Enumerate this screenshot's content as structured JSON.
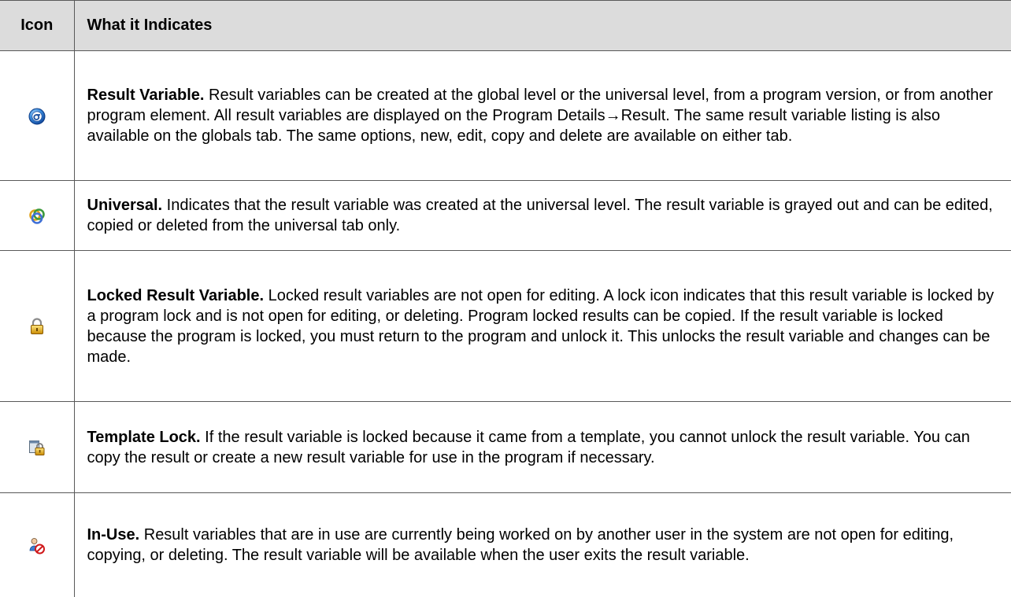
{
  "table": {
    "headers": {
      "icon": "Icon",
      "description": "What it Indicates"
    },
    "rows": [
      {
        "icon": "result-variable-sigma-icon",
        "title": "Result Variable.",
        "text_part1": " Result variables can be created at the global level or the universal level, from a program version, or from another program element. All result variables are displayed on the Program Details",
        "arrow": "→",
        "text_part2": "Result. The same result variable listing is also available on the globals tab. The same options, new, edit, copy and delete are available on either tab."
      },
      {
        "icon": "universal-rings-icon",
        "title": "Universal.",
        "text": " Indicates that the result variable was created at the universal level. The result variable is grayed out and can be edited, copied or deleted from the universal tab only."
      },
      {
        "icon": "lock-icon",
        "title": "Locked Result Variable.",
        "text": " Locked result variables are not open for editing. A lock icon indicates that this result variable is locked by a program lock and is not open for editing, or deleting. Program locked results can be copied. If the result variable is locked because the program is locked, you must return to the program and unlock it. This unlocks the result variable and changes can be made."
      },
      {
        "icon": "template-lock-icon",
        "title": "Template Lock.",
        "text": " If the result variable is locked because it came from a template, you cannot unlock the result variable. You can copy the result or create a new result variable for use in the program if necessary."
      },
      {
        "icon": "in-use-user-icon",
        "title": "In-Use.",
        "text": " Result variables that are in use are currently being worked on by another user in the system are not open for editing, copying, or deleting. The result variable will be available when the user exits the result variable."
      }
    ]
  }
}
